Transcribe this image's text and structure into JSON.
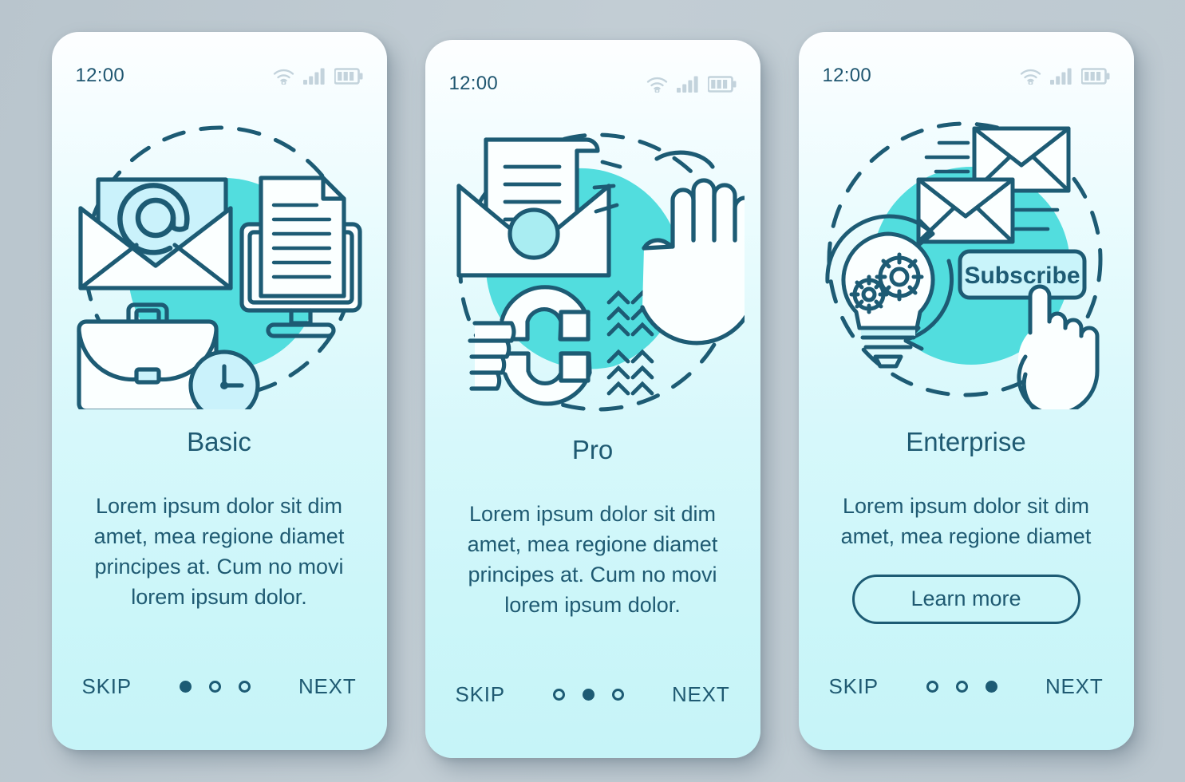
{
  "theme": {
    "page_background": "#bdc9d1",
    "card_gradient_top": "#fdfeff",
    "card_gradient_bottom": "#c6f4f8",
    "accent_turquoise": "#52ddde",
    "stroke_dark": "#1d5b74",
    "text_dark": "#1f5a72",
    "status_icon_color": "#c3d3dc"
  },
  "screens": [
    {
      "status": {
        "time": "12:00",
        "icons": [
          "wifi-icon",
          "signal-icon",
          "battery-icon"
        ]
      },
      "illustration": {
        "name": "basic-email-workspace-illustration",
        "elements": [
          "envelope-at-symbol",
          "monitor-document",
          "briefcase",
          "clock"
        ]
      },
      "title": "Basic",
      "description": "Lorem ipsum dolor sit dim amet, mea regione diamet principes at. Cum no movi lorem ipsum dolor.",
      "has_button": false,
      "button_label": "",
      "footer": {
        "skip_label": "SKIP",
        "next_label": "NEXT",
        "dots": 3,
        "active_dot": 0
      }
    },
    {
      "status": {
        "time": "12:00",
        "icons": [
          "wifi-icon",
          "signal-icon",
          "battery-icon"
        ]
      },
      "illustration": {
        "name": "pro-email-magnet-stop-illustration",
        "elements": [
          "open-envelope-letter",
          "hand-magnet",
          "stop-hand-palm"
        ]
      },
      "title": "Pro",
      "description": "Lorem ipsum dolor sit dim amet, mea regione diamet principes at. Cum no movi lorem ipsum dolor.",
      "has_button": false,
      "button_label": "",
      "footer": {
        "skip_label": "SKIP",
        "next_label": "NEXT",
        "dots": 3,
        "active_dot": 1
      }
    },
    {
      "status": {
        "time": "12:00",
        "icons": [
          "wifi-icon",
          "signal-icon",
          "battery-icon"
        ]
      },
      "illustration": {
        "name": "enterprise-subscribe-automation-illustration",
        "elements": [
          "flying-envelopes",
          "lightbulb-gears-cycle",
          "subscribe-button",
          "pointing-hand-cursor"
        ],
        "subscribe_label": "Subscribe"
      },
      "title": "Enterprise",
      "description": "Lorem ipsum dolor sit dim amet, mea regione diamet",
      "has_button": true,
      "button_label": "Learn more",
      "footer": {
        "skip_label": "SKIP",
        "next_label": "NEXT",
        "dots": 3,
        "active_dot": 2
      }
    }
  ]
}
